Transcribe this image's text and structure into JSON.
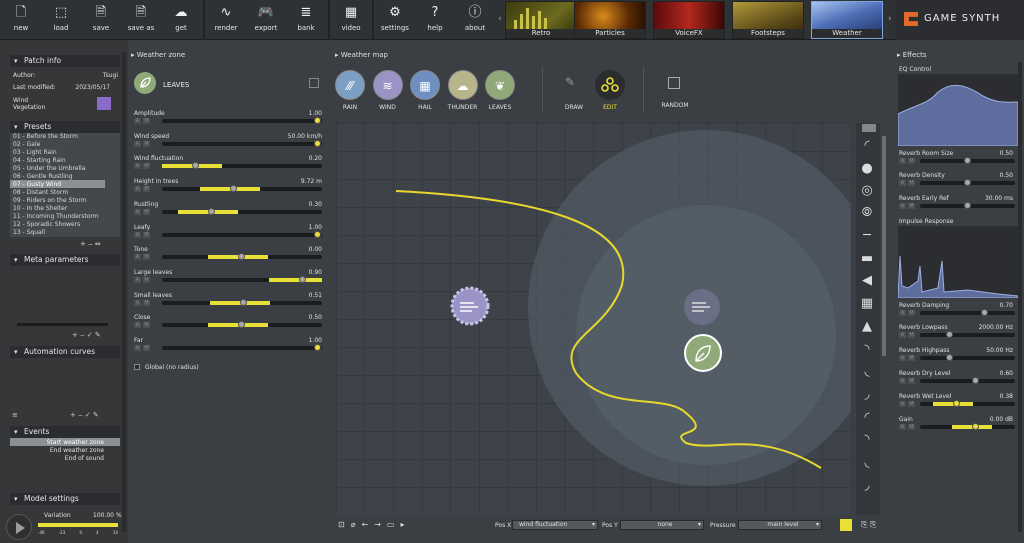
{
  "toolbar": {
    "new": "new",
    "load": "load",
    "save": "save",
    "save_as": "save as",
    "get": "get",
    "render": "render",
    "export": "export",
    "bank": "bank",
    "video": "video",
    "settings": "settings",
    "help": "help",
    "about": "about"
  },
  "models": [
    "Retro",
    "Particles",
    "VoiceFX",
    "Footsteps",
    "Weather"
  ],
  "brand": "GAME SYNTH",
  "patch_info": {
    "title": "Patch info",
    "author_label": "Author:",
    "author": "Tsugi",
    "modified_label": "Last modified:",
    "modified": "2023/05/17",
    "tags": [
      "Wind",
      "Vegetation"
    ]
  },
  "presets": {
    "title": "Presets",
    "items": [
      "01 - Before the Storm",
      "02 - Gale",
      "03 - Light Rain",
      "04 - Starting Rain",
      "05 - Under the Umbrella",
      "06 - Gentle Rustling",
      "07 - Gusty Wind",
      "08 - Distant Storm",
      "09 - Riders on the Storm",
      "10 - In the Shelter",
      "11 - Incoming Thunderstorm",
      "12 - Sporadic Showers",
      "13 - Squall"
    ]
  },
  "meta_title": "Meta parameters",
  "automation_title": "Automation curves",
  "events": {
    "title": "Events",
    "items": [
      "Start weather zone",
      "End weather zone",
      "End of sound"
    ]
  },
  "model_settings": {
    "title": "Model settings",
    "variation_label": "Variation",
    "variation_value": "100.00",
    "variation_unit": "%",
    "scale": [
      "-46",
      "-23",
      "0",
      "4",
      "14"
    ]
  },
  "weather_zone": {
    "title": "Weather zone",
    "zone_name": "LEAVES",
    "params": [
      {
        "label": "Amplitude",
        "value": "1.00",
        "level": 1.0
      },
      {
        "label": "Wind speed",
        "value": "50.00 km/h",
        "level": 1.0
      },
      {
        "label": "Wind fluctuation",
        "value": "0.20",
        "level": 0.2
      },
      {
        "label": "Height in trees",
        "value": "9.72 m",
        "level": 0.45
      },
      {
        "label": "Rustling",
        "value": "0.30",
        "level": 0.3
      },
      {
        "label": "Leafy",
        "value": "1.00",
        "level": 1.0
      },
      {
        "label": "Tone",
        "value": "0.00",
        "level": 0.5
      },
      {
        "label": "Large leaves",
        "value": "0.90",
        "level": 0.9
      },
      {
        "label": "Small leaves",
        "value": "0.51",
        "level": 0.51
      },
      {
        "label": "Close",
        "value": "0.50",
        "level": 0.5
      },
      {
        "label": "Far",
        "value": "1.00",
        "level": 1.0
      }
    ],
    "global_label": "Global (no radius)"
  },
  "weather_map": {
    "title": "Weather map",
    "zones": [
      "RAIN",
      "WIND",
      "HAIL",
      "THUNDER",
      "LEAVES"
    ],
    "tools": [
      "DRAW",
      "EDIT",
      "RANDOM"
    ]
  },
  "bottom": {
    "posx_label": "Pos X",
    "posx_value": "wind fluctuation",
    "posy_label": "Pos Y",
    "posy_value": "none",
    "pressure_label": "Pressure",
    "pressure_value": "main level"
  },
  "effects": {
    "title": "Effects",
    "eq_label": "EQ Control",
    "impulse_label": "Impulse Response",
    "params": [
      {
        "label": "Reverb Room Size",
        "value": "0.50",
        "level": 0.5
      },
      {
        "label": "Reverb Density",
        "value": "0.50",
        "level": 0.5
      },
      {
        "label": "Reverb Early Ref",
        "value": "30.00 ms",
        "level": 0.5
      },
      {
        "label": "Reverb Damping",
        "value": "0.70",
        "level": 0.7
      },
      {
        "label": "Reverb Lowpass",
        "value": "2000.00 Hz",
        "level": 0.3
      },
      {
        "label": "Reverb Highpass",
        "value": "50.00 Hz",
        "level": 0.3
      },
      {
        "label": "Reverb Dry Level",
        "value": "0.60",
        "level": 0.6
      },
      {
        "label": "Reverb Wet Level",
        "value": "0.38",
        "level": 0.38
      },
      {
        "label": "Gain",
        "value": "0.00 dB",
        "level": 0.6
      }
    ]
  },
  "colors": {
    "accent": "#e8e037",
    "rain": "#7c9fc4",
    "wind": "#9a93c6",
    "hail": "#6f8fc0",
    "thunder": "#b8b48c",
    "leaves": "#8faa78"
  }
}
